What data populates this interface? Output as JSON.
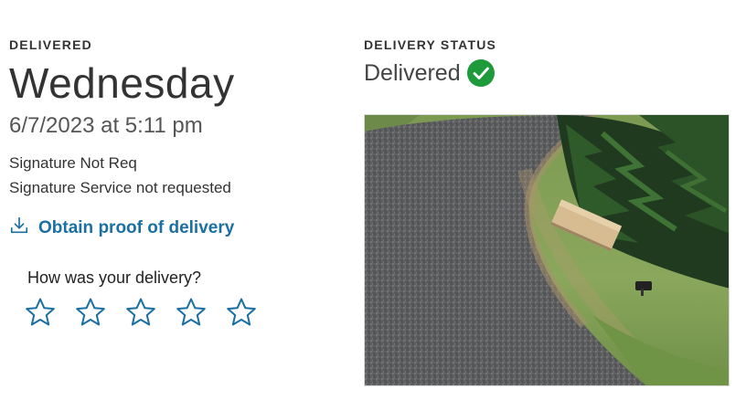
{
  "delivery": {
    "eyebrow": "DELIVERED",
    "day": "Wednesday",
    "datetime": "6/7/2023 at 5:11 pm",
    "signature_line1": "Signature Not Req",
    "signature_line2": "Signature Service not requested",
    "proof_link": "Obtain proof of delivery",
    "proof_icon": "download-icon"
  },
  "rating": {
    "question": "How was your delivery?",
    "max_stars": 5,
    "selected": 0,
    "star_icon": "star-outline-icon"
  },
  "status": {
    "eyebrow": "DELIVERY STATUS",
    "text": "Delivered",
    "check_icon": "check-circle-icon"
  },
  "colors": {
    "link": "#1a6fa3",
    "star_outline": "#1a6fa3",
    "check_green": "#1f9a3a",
    "text_dark": "#333333"
  }
}
